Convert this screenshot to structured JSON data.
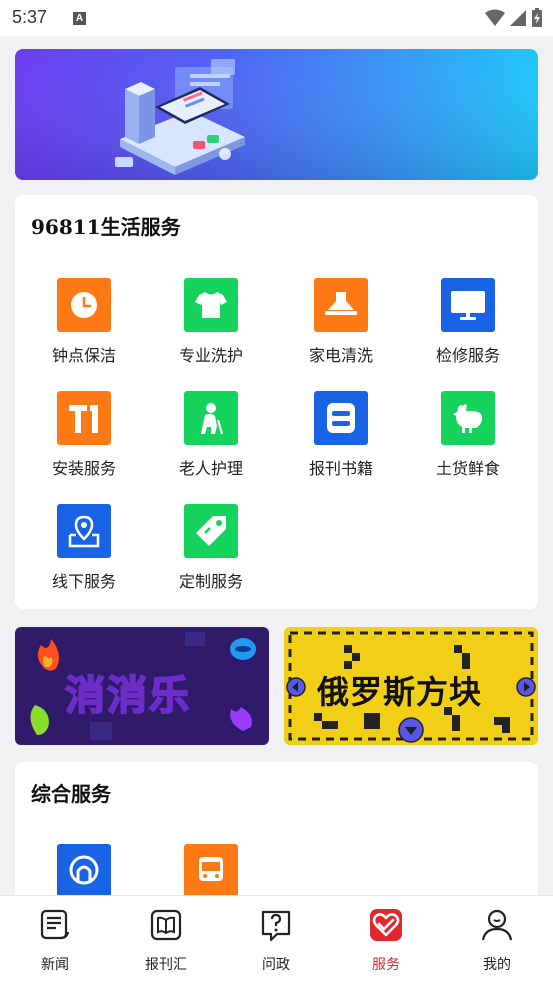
{
  "status_bar": {
    "time": "5:37",
    "notification_letter": "A"
  },
  "life_services": {
    "title": "96811生活服务",
    "items": [
      {
        "label": "钟点保洁",
        "icon": "clock-icon",
        "color": "#ff7a14"
      },
      {
        "label": "专业洗护",
        "icon": "tshirt-icon",
        "color": "#16d35e"
      },
      {
        "label": "家电清洗",
        "icon": "range-hood-icon",
        "color": "#ff7a14"
      },
      {
        "label": "检修服务",
        "icon": "monitor-icon",
        "color": "#1863e6"
      },
      {
        "label": "安装服务",
        "icon": "installation-icon",
        "color": "#ff7a14"
      },
      {
        "label": "老人护理",
        "icon": "elderly-icon",
        "color": "#16d35e"
      },
      {
        "label": "报刊书籍",
        "icon": "book-icon",
        "color": "#1863e6"
      },
      {
        "label": "土货鲜食",
        "icon": "chicken-icon",
        "color": "#16d35e"
      },
      {
        "label": "线下服务",
        "icon": "map-pin-icon",
        "color": "#1863e6"
      },
      {
        "label": "定制服务",
        "icon": "tag-icon",
        "color": "#16d35e"
      }
    ]
  },
  "games": {
    "left": {
      "title": "消消乐"
    },
    "right": {
      "title": "俄罗斯方块"
    }
  },
  "general_services": {
    "title": "综合服务",
    "items": [
      {
        "icon": "railway-icon",
        "color": "#1863e6"
      },
      {
        "icon": "bus-icon",
        "color": "#ff7a14"
      }
    ]
  },
  "bottom_nav": {
    "active": "服务",
    "items": [
      {
        "label": "新闻",
        "icon": "news-icon"
      },
      {
        "label": "报刊汇",
        "icon": "book-open-icon"
      },
      {
        "label": "问政",
        "icon": "question-icon"
      },
      {
        "label": "服务",
        "icon": "heart-service-icon"
      },
      {
        "label": "我的",
        "icon": "profile-icon"
      }
    ]
  },
  "colors": {
    "accent": "#e1262d",
    "orange": "#ff7a14",
    "green": "#16d35e",
    "blue": "#1863e6"
  }
}
